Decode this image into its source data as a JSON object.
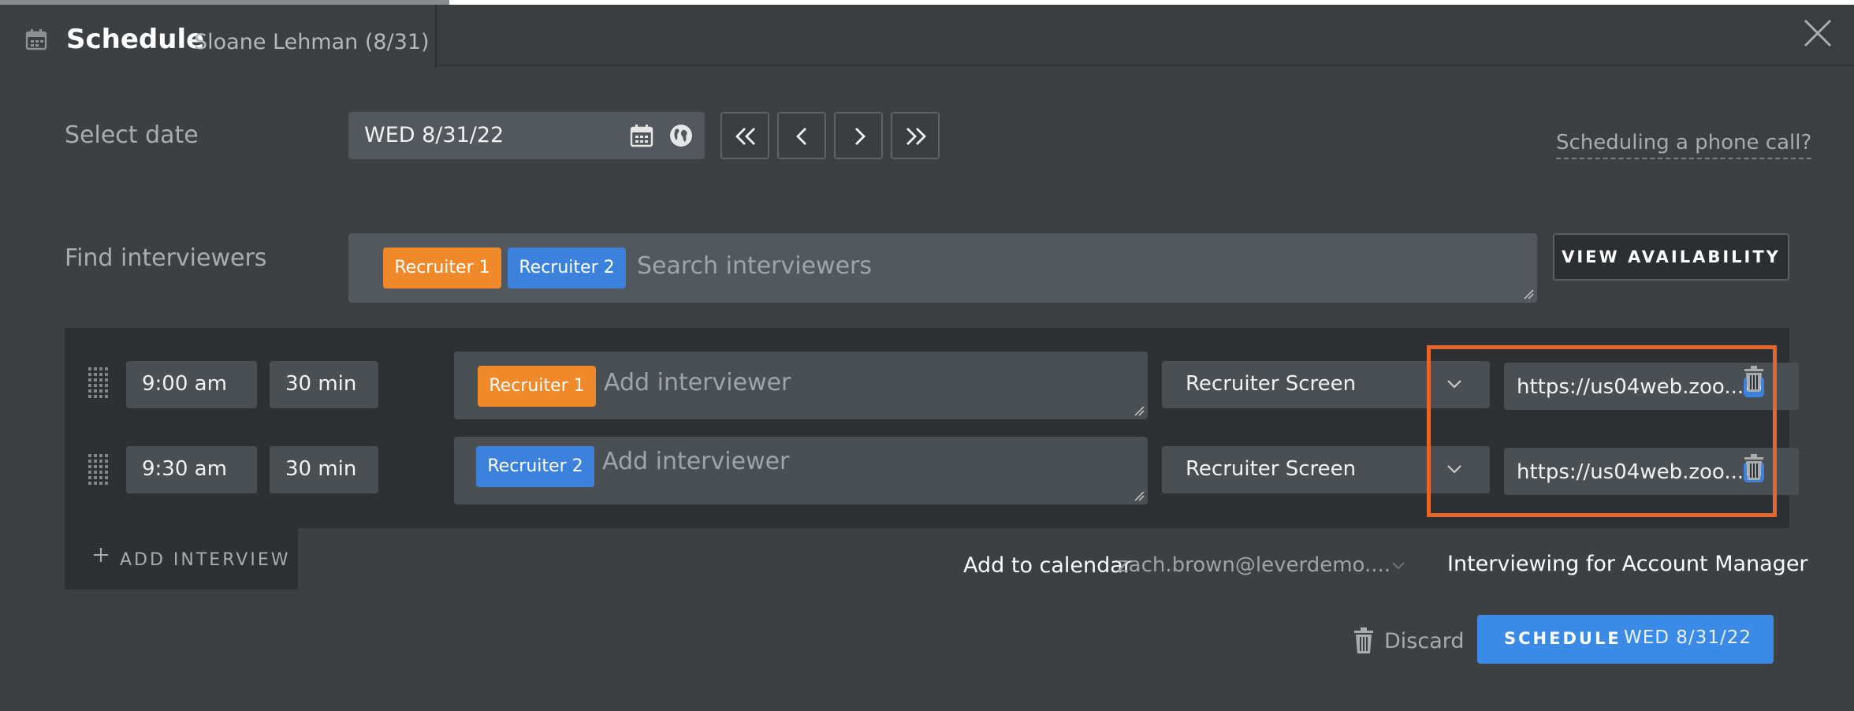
{
  "header": {
    "title": "Schedule",
    "subtitle": "Sloane Lehman (8/31)"
  },
  "date_section": {
    "label": "Select date",
    "value": "WED 8/31/22",
    "phone_link": "Scheduling a phone call?"
  },
  "find_interviewers": {
    "label": "Find interviewers",
    "tags": [
      "Recruiter 1",
      "Recruiter 2"
    ],
    "placeholder": "Search interviewers",
    "view_availability": "VIEW AVAILABILITY"
  },
  "interviews": [
    {
      "time": "9:00 am",
      "duration": "30 min",
      "interviewer": "Recruiter 1",
      "interviewer_color": "#f0892a",
      "placeholder": "Add interviewer",
      "stage": "Recruiter Screen",
      "link": "https://us04web.zoo..."
    },
    {
      "time": "9:30 am",
      "duration": "30 min",
      "interviewer": "Recruiter 2",
      "interviewer_color": "#3c82dc",
      "placeholder": "Add interviewer",
      "stage": "Recruiter Screen",
      "link": "https://us04web.zoo..."
    }
  ],
  "add_interview": "ADD INTERVIEW",
  "calendar": {
    "label": "Add to calendar",
    "email": "zach.brown@leverdemo...."
  },
  "interviewing_for": "Interviewing for Account Manager",
  "footer": {
    "discard": "Discard",
    "schedule_label": "SCHEDULE",
    "schedule_date": "WED 8/31/22"
  },
  "colors": {
    "accent": "#3a8ae6",
    "highlight": "#e4662e",
    "tag_orange": "#f0892a",
    "tag_blue": "#3c82dc"
  }
}
